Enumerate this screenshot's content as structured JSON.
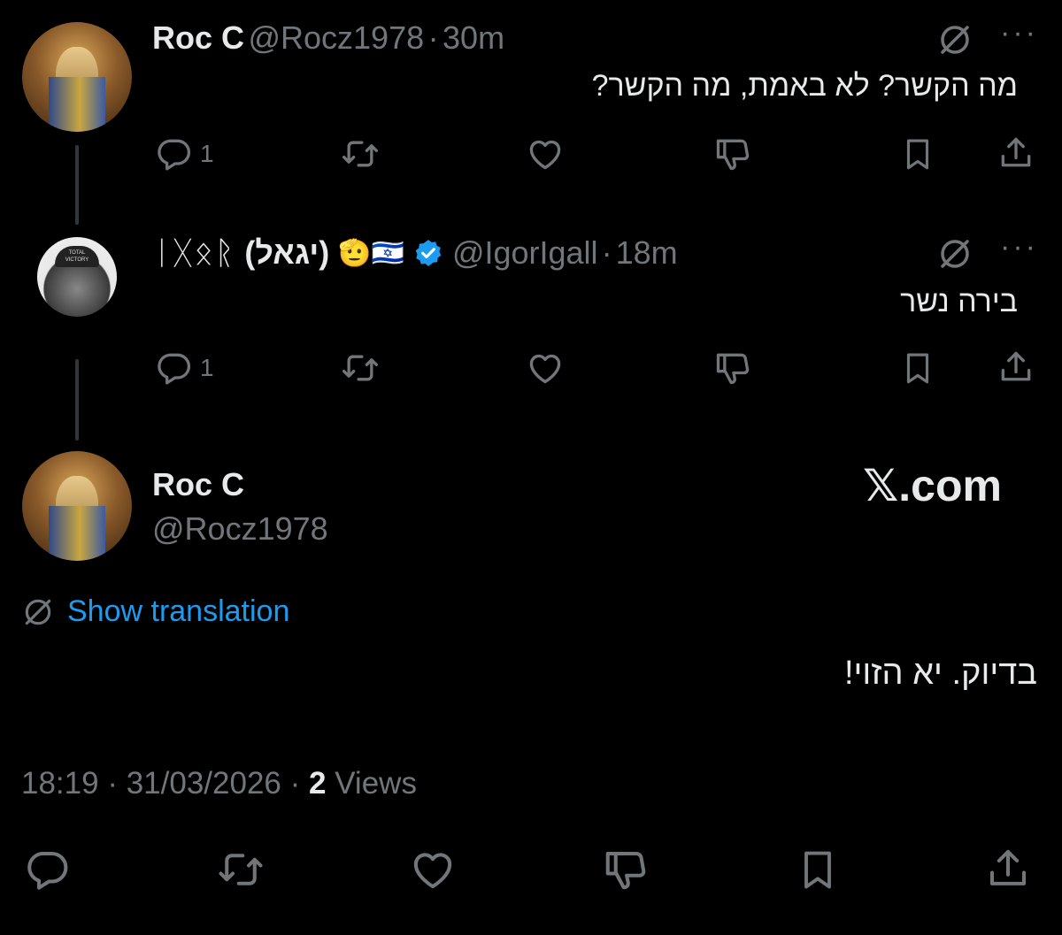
{
  "tweets": [
    {
      "name": "Roc C",
      "handle": "@Rocz1978",
      "sep": "·",
      "time": "30m",
      "text": "מה הקשר? לא באמת, מה הקשר?",
      "reply_count": "1",
      "more": "···"
    },
    {
      "name_runes": "ᛁᚷᛟᚱ",
      "name_hebrew": "(יגאל)",
      "name_emoji": "🫡🇮🇱",
      "handle": "@IgorIgall",
      "sep": "·",
      "time": "18m",
      "text": "בירה נשר",
      "reply_count": "1",
      "more": "···",
      "avatar_cap": [
        "TOTAL",
        "VICTORY"
      ]
    }
  ],
  "main_tweet": {
    "name": "Roc C",
    "handle": "@Rocz1978",
    "watermark": "𝕏.com",
    "show_translation": "Show translation",
    "text": "בדיוק. יא הזוי!",
    "time": "18:19",
    "sep1": "·",
    "date": "31/03/2026",
    "sep2": "·",
    "views_count": "2",
    "views_label": "Views"
  },
  "colors": {
    "background": "#000000",
    "text": "#e7e9ea",
    "muted": "#71767b",
    "accent": "#1d9bf0",
    "verified": "#1d9bf0"
  },
  "icons": [
    "reply-icon",
    "retweet-icon",
    "like-icon",
    "dislike-icon",
    "bookmark-icon",
    "share-icon",
    "translate-icon",
    "verified-badge-icon"
  ]
}
